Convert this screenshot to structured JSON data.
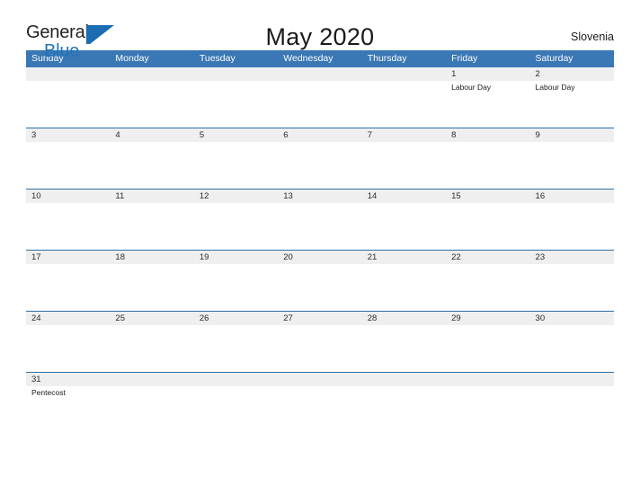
{
  "brand": {
    "name_line1": "General",
    "name_line2": "Blue",
    "mark": "triangle-flag-icon",
    "color_dark": "#231f20",
    "color_blue": "#2073b8"
  },
  "header": {
    "title": "May 2020",
    "country": "Slovenia"
  },
  "colors": {
    "header_blue": "#3a77b5",
    "divider_blue": "#2e6da4",
    "date_band_gray": "#efefef",
    "text_dark": "#1a1a1a"
  },
  "weekdays": [
    "Sunday",
    "Monday",
    "Tuesday",
    "Wednesday",
    "Thursday",
    "Friday",
    "Saturday"
  ],
  "weeks": [
    {
      "days": [
        {
          "date": "",
          "events": []
        },
        {
          "date": "",
          "events": []
        },
        {
          "date": "",
          "events": []
        },
        {
          "date": "",
          "events": []
        },
        {
          "date": "",
          "events": []
        },
        {
          "date": "1",
          "events": [
            "Labour Day"
          ]
        },
        {
          "date": "2",
          "events": [
            "Labour Day"
          ]
        }
      ]
    },
    {
      "days": [
        {
          "date": "3",
          "events": []
        },
        {
          "date": "4",
          "events": []
        },
        {
          "date": "5",
          "events": []
        },
        {
          "date": "6",
          "events": []
        },
        {
          "date": "7",
          "events": []
        },
        {
          "date": "8",
          "events": []
        },
        {
          "date": "9",
          "events": []
        }
      ]
    },
    {
      "days": [
        {
          "date": "10",
          "events": []
        },
        {
          "date": "11",
          "events": []
        },
        {
          "date": "12",
          "events": []
        },
        {
          "date": "13",
          "events": []
        },
        {
          "date": "14",
          "events": []
        },
        {
          "date": "15",
          "events": []
        },
        {
          "date": "16",
          "events": []
        }
      ]
    },
    {
      "days": [
        {
          "date": "17",
          "events": []
        },
        {
          "date": "18",
          "events": []
        },
        {
          "date": "19",
          "events": []
        },
        {
          "date": "20",
          "events": []
        },
        {
          "date": "21",
          "events": []
        },
        {
          "date": "22",
          "events": []
        },
        {
          "date": "23",
          "events": []
        }
      ]
    },
    {
      "days": [
        {
          "date": "24",
          "events": []
        },
        {
          "date": "25",
          "events": []
        },
        {
          "date": "26",
          "events": []
        },
        {
          "date": "27",
          "events": []
        },
        {
          "date": "28",
          "events": []
        },
        {
          "date": "29",
          "events": []
        },
        {
          "date": "30",
          "events": []
        }
      ]
    },
    {
      "days": [
        {
          "date": "31",
          "events": [
            "Pentecost"
          ]
        },
        {
          "date": "",
          "events": []
        },
        {
          "date": "",
          "events": []
        },
        {
          "date": "",
          "events": []
        },
        {
          "date": "",
          "events": []
        },
        {
          "date": "",
          "events": []
        },
        {
          "date": "",
          "events": []
        }
      ]
    }
  ]
}
